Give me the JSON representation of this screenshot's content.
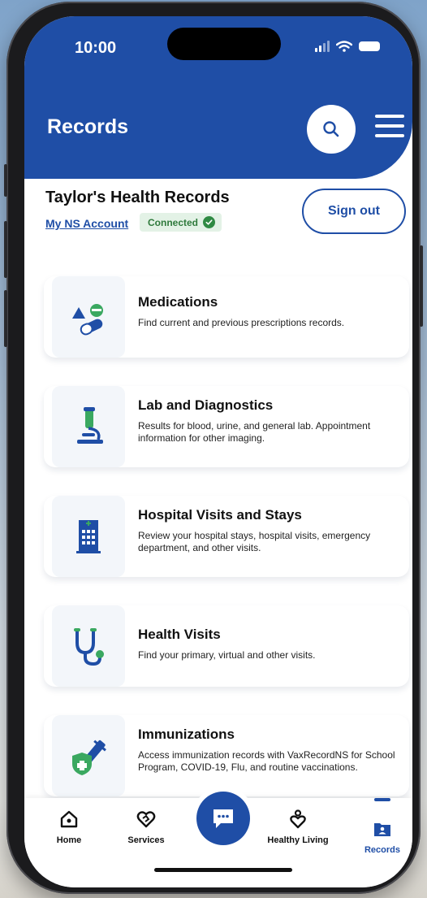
{
  "status_bar": {
    "time": "10:00"
  },
  "header": {
    "title": "Records"
  },
  "profile": {
    "name": "Taylor's Health Records",
    "account_link": "My NS Account",
    "status_badge": "Connected",
    "sign_out": "Sign out"
  },
  "records": [
    {
      "icon": "pills-icon",
      "title": "Medications",
      "desc": "Find current and previous prescriptions records."
    },
    {
      "icon": "microscope-icon",
      "title": "Lab and Diagnostics",
      "desc": "Results for blood, urine, and general lab. Appointment information for other imaging."
    },
    {
      "icon": "hospital-icon",
      "title": "Hospital Visits and Stays",
      "desc": "Review your hospital stays, hospital visits, emergency department, and other visits."
    },
    {
      "icon": "stethoscope-icon",
      "title": "Health Visits",
      "desc": "Find your primary, virtual and other visits."
    },
    {
      "icon": "vaccine-shield-icon",
      "title": "Immunizations",
      "desc": "Access immunization records with VaxRecordNS for School Program, COVID-19, Flu, and routine vaccinations."
    }
  ],
  "nav": {
    "home": "Home",
    "services": "Services",
    "healthy_living": "Healthy Living",
    "records": "Records"
  },
  "colors": {
    "brand": "#1f4ea6",
    "success": "#2f8a43"
  }
}
